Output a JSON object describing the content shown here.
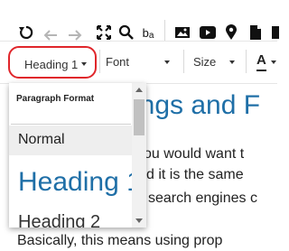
{
  "toolbar_top": {
    "icons": [
      "undo-icon",
      "redo-back-icon",
      "redo-forward-icon",
      "fullscreen-icon",
      "search-icon",
      "find-replace-icon",
      "image-icon",
      "video-icon",
      "map-pin-icon",
      "file-icon",
      "more-icon"
    ],
    "replace_glyph": "b",
    "replace_glyph2": "a"
  },
  "toolbar_format": {
    "paragraph_format_value": "Heading 1",
    "font_label": "Font",
    "size_label": "Size",
    "text_color_label": "A"
  },
  "format_dropdown": {
    "title": "Paragraph Format",
    "options": [
      "Normal",
      "Heading 1",
      "Heading 2"
    ],
    "selected": "Normal"
  },
  "document": {
    "heading_visible": "ings and F",
    "lines": [
      "ou would want t",
      "d it is the same",
      "search engines c",
      "Basically, this means using prop"
    ]
  },
  "colors": {
    "accent_red": "#e0262b",
    "heading_blue": "#1f6fa7"
  }
}
